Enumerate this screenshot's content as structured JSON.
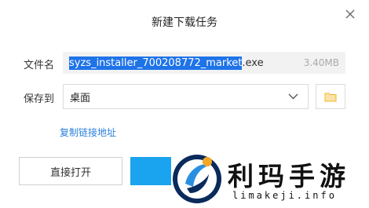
{
  "dialog": {
    "title": "新建下载任务",
    "file_name_label": "文件名",
    "file_name_selected": "syzs_installer_700208772_market",
    "file_name_ext": ".exe",
    "file_size": "3.40MB",
    "save_to_label": "保存到",
    "save_to_value": "桌面",
    "copy_link_label": "复制链接地址",
    "open_direct_label": "直接打开"
  },
  "watermark": {
    "text": "利玛手游",
    "url": "limakeji.info"
  },
  "icons": {
    "close": "close-icon",
    "dropdown": "chevron-down-icon",
    "folder": "folder-icon",
    "logo": "watermark-logo"
  },
  "colors": {
    "selection": "#1e73e8",
    "link": "#2a7fd9",
    "primary_button": "#1aa3ee",
    "folder_icon": "#f3b531"
  }
}
